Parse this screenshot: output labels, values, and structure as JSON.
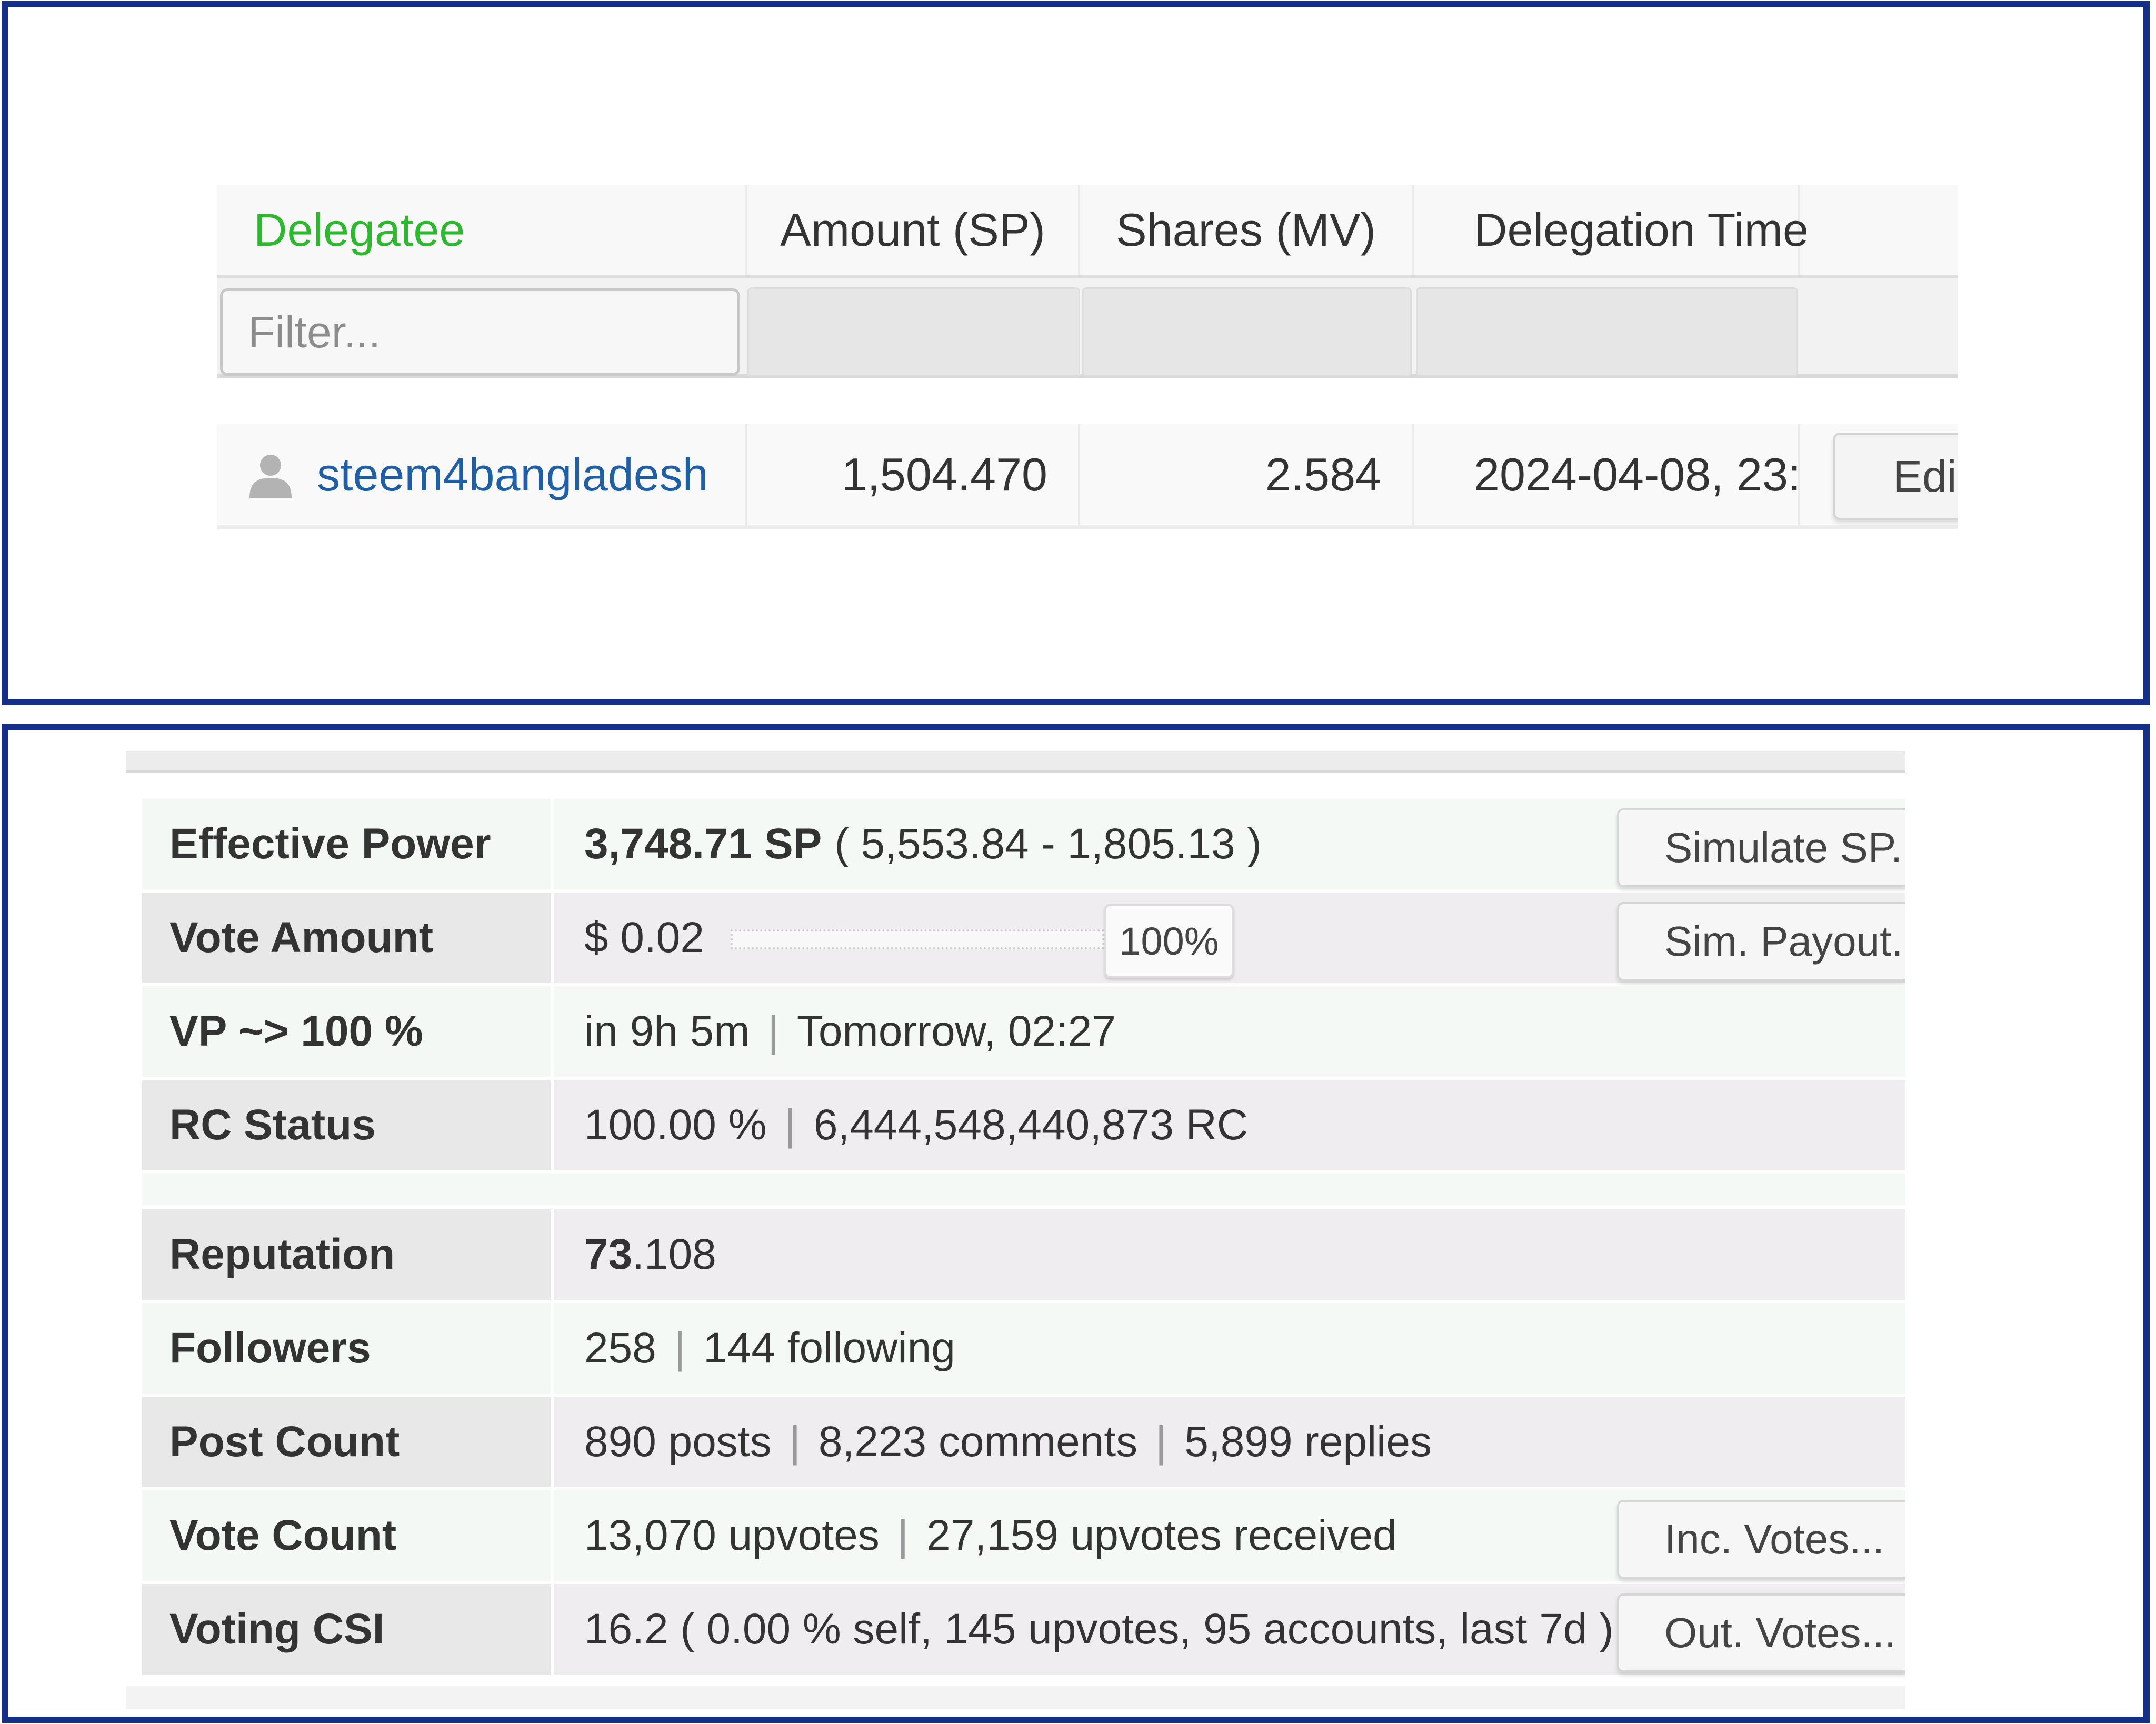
{
  "delegation": {
    "headers": {
      "delegatee": "Delegatee",
      "amount": "Amount (SP)",
      "shares": "Shares (MV)",
      "time": "Delegation Time"
    },
    "filter_placeholder": "Filter...",
    "rows": [
      {
        "delegatee": "steem4bangladesh",
        "amount": "1,504.470",
        "shares": "2.584",
        "time": "2024-04-08, 23:",
        "edit_label": "Edi"
      }
    ]
  },
  "stats": {
    "effective_power": {
      "label": "Effective Power",
      "value": "3,748.71 SP",
      "detail": "( 5,553.84 - 1,805.13 )",
      "button": "Simulate SP..."
    },
    "vote_amount": {
      "label": "Vote Amount",
      "value": "$ 0.02",
      "slider_label": "100%",
      "slider_value": 1.0,
      "button": "Sim. Payout..."
    },
    "vp": {
      "label": "VP ~> 100 %",
      "in": "in 9h 5m",
      "at": "Tomorrow, 02:27"
    },
    "rc_status": {
      "label": "RC Status",
      "percent": "100.00 %",
      "amount": "6,444,548,440,873 RC"
    },
    "reputation": {
      "label": "Reputation",
      "major": "73",
      "minor": ".108"
    },
    "followers": {
      "label": "Followers",
      "count": "258",
      "following": "144 following"
    },
    "post_count": {
      "label": "Post Count",
      "posts": "890 posts",
      "comments": "8,223 comments",
      "replies": "5,899 replies"
    },
    "vote_count": {
      "label": "Vote Count",
      "upvotes": "13,070 upvotes",
      "received": "27,159 upvotes received",
      "button": "Inc. Votes..."
    },
    "voting_csi": {
      "label": "Voting CSI",
      "value": "16.2 ( 0.00 % self, 145 upvotes, 95 accounts, last 7d )",
      "button": "Out. Votes..."
    }
  },
  "colors": {
    "frame": "#142e8a",
    "sorted_header": "#2db92d",
    "link": "#1f5fa8"
  }
}
